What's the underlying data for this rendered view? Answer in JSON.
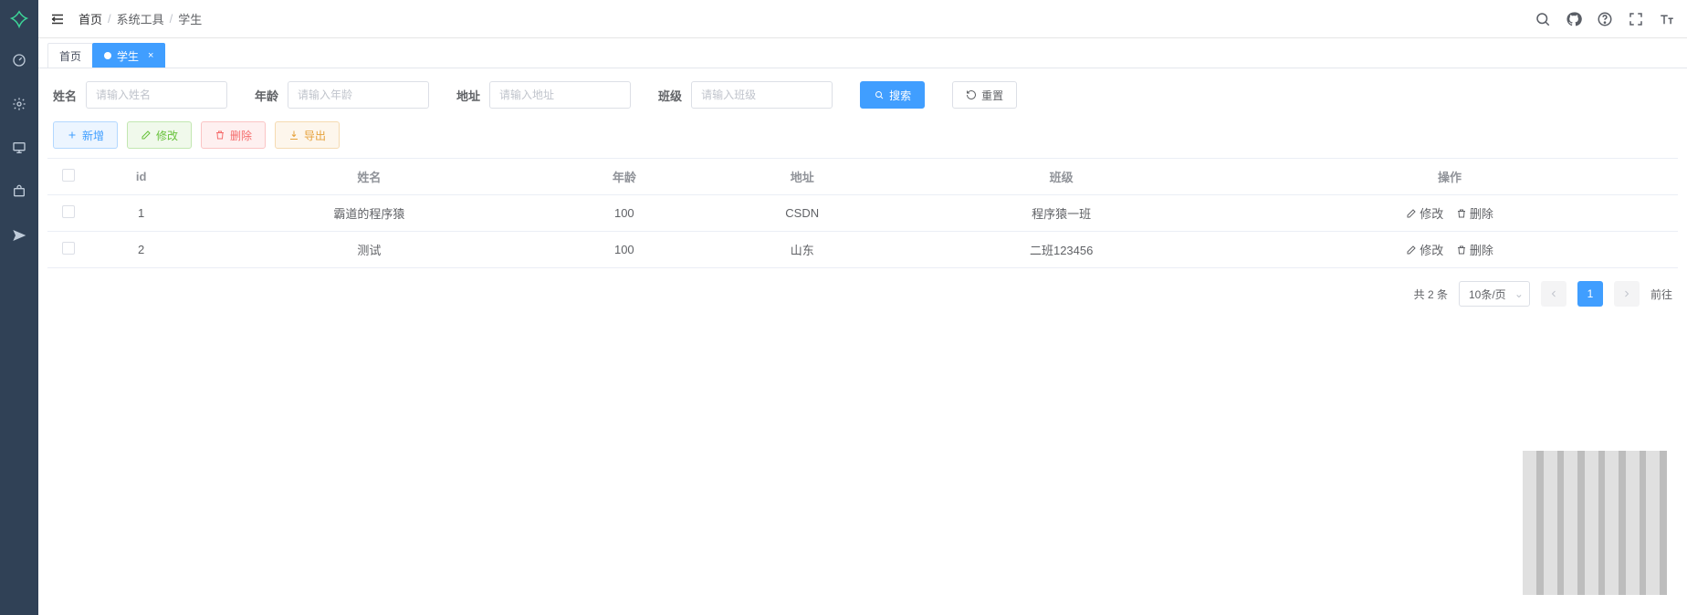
{
  "breadcrumb": {
    "home": "首页",
    "mid": "系统工具",
    "last": "学生"
  },
  "tabs": {
    "home": "首页",
    "student": "学生",
    "close": "×"
  },
  "search": {
    "name_label": "姓名",
    "name_ph": "请输入姓名",
    "age_label": "年龄",
    "age_ph": "请输入年龄",
    "addr_label": "地址",
    "addr_ph": "请输入地址",
    "class_label": "班级",
    "class_ph": "请输入班级",
    "search_btn": "搜索",
    "reset_btn": "重置"
  },
  "toolbar": {
    "add": "新增",
    "edit": "修改",
    "delete": "删除",
    "export": "导出"
  },
  "columns": {
    "id": "id",
    "name": "姓名",
    "age": "年龄",
    "addr": "地址",
    "class": "班级",
    "ops": "操作"
  },
  "rows": [
    {
      "id": "1",
      "name": "霸道的程序猿",
      "age": "100",
      "addr": "CSDN",
      "class": "程序猿一班"
    },
    {
      "id": "2",
      "name": "测试",
      "age": "100",
      "addr": "山东",
      "class": "二班123456"
    }
  ],
  "row_ops": {
    "edit": "修改",
    "delete": "删除"
  },
  "pagination": {
    "total": "共 2 条",
    "per_page": "10条/页",
    "page1": "1",
    "goto": "前往"
  }
}
